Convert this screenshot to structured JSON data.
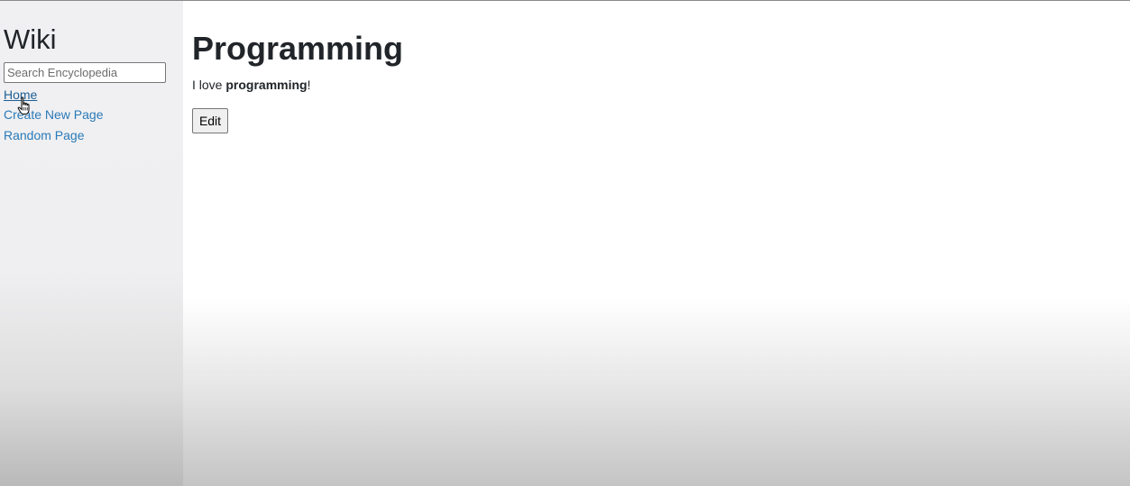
{
  "sidebar": {
    "title": "Wiki",
    "search": {
      "placeholder": "Search Encyclopedia",
      "value": ""
    },
    "links": {
      "home": "Home",
      "create": "Create New Page",
      "random": "Random Page"
    }
  },
  "main": {
    "title": "Programming",
    "body": {
      "prefix": "I love ",
      "bold": "programming",
      "suffix": "!"
    },
    "edit_label": "Edit"
  },
  "icons": {
    "cursor": "hand-pointer-icon"
  },
  "colors": {
    "link": "#2a7ab8",
    "sidebar_bg": "#f0f0f2",
    "text": "#212529"
  }
}
